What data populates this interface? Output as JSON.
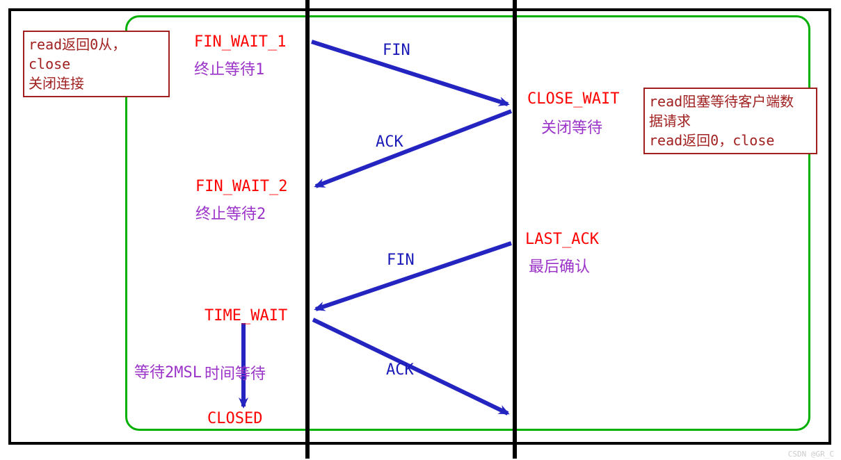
{
  "states": {
    "fin_wait_1": "FIN_WAIT_1",
    "fin_wait_1_desc": "终止等待1",
    "close_wait": "CLOSE_WAIT",
    "close_wait_desc": "关闭等待",
    "fin_wait_2": "FIN_WAIT_2",
    "fin_wait_2_desc": "终止等待2",
    "last_ack": "LAST_ACK",
    "last_ack_desc": "最后确认",
    "time_wait": "TIME_WAIT",
    "time_wait_desc": "时间等待",
    "closed": "CLOSED"
  },
  "messages": {
    "fin1": "FIN",
    "ack1": "ACK",
    "fin2": "FIN",
    "ack2": "ACK"
  },
  "notes": {
    "left_line1": "read返回0从，close",
    "left_line2": "关闭连接",
    "right_line1": "read阻塞等待客户端数",
    "right_line2": "据请求",
    "right_line3": "read返回0，close",
    "wait_2msl": "等待2MSL"
  },
  "watermark": "CSDN @GR_C"
}
